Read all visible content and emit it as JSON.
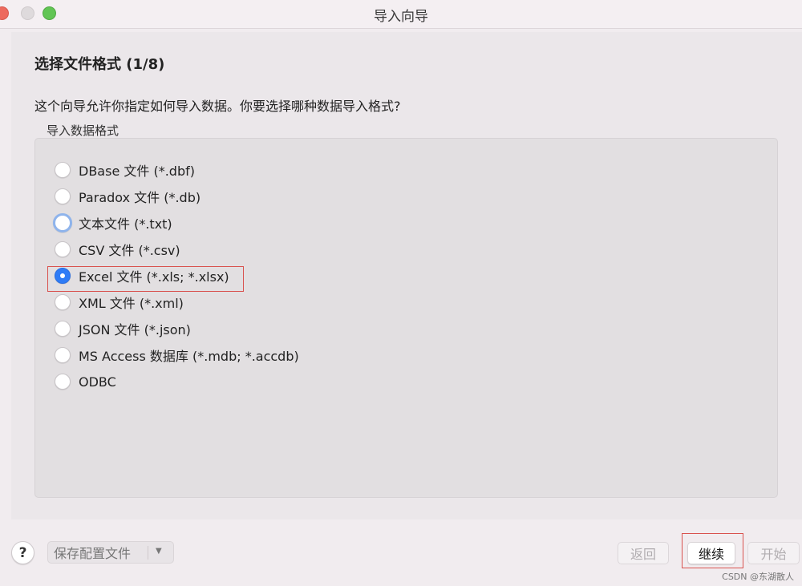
{
  "window": {
    "title": "导入向导"
  },
  "page": {
    "step_title": "选择文件格式 (1/8)",
    "question": "这个向导允许你指定如何导入数据。你要选择哪种数据导入格式?",
    "group_label": "导入数据格式"
  },
  "options": [
    {
      "label": "DBase 文件 (*.dbf)",
      "selected": false,
      "focused": false
    },
    {
      "label": "Paradox 文件 (*.db)",
      "selected": false,
      "focused": false
    },
    {
      "label": "文本文件 (*.txt)",
      "selected": false,
      "focused": true
    },
    {
      "label": "CSV 文件 (*.csv)",
      "selected": false,
      "focused": false
    },
    {
      "label": "Excel 文件 (*.xls; *.xlsx)",
      "selected": true,
      "focused": false
    },
    {
      "label": "XML 文件 (*.xml)",
      "selected": false,
      "focused": false
    },
    {
      "label": "JSON 文件 (*.json)",
      "selected": false,
      "focused": false
    },
    {
      "label": "MS Access 数据库 (*.mdb; *.accdb)",
      "selected": false,
      "focused": false
    },
    {
      "label": "ODBC",
      "selected": false,
      "focused": false
    }
  ],
  "footer": {
    "help_label": "?",
    "save_profile_label": "保存配置文件",
    "save_profile_arrow": "▼",
    "back_label": "返回",
    "continue_label": "继续",
    "start_label": "开始",
    "watermark": "CSDN @东湖散人"
  },
  "colors": {
    "accent": "#2f7cf6",
    "annotation": "#d9534f",
    "window_bg": "#f1ecef"
  }
}
